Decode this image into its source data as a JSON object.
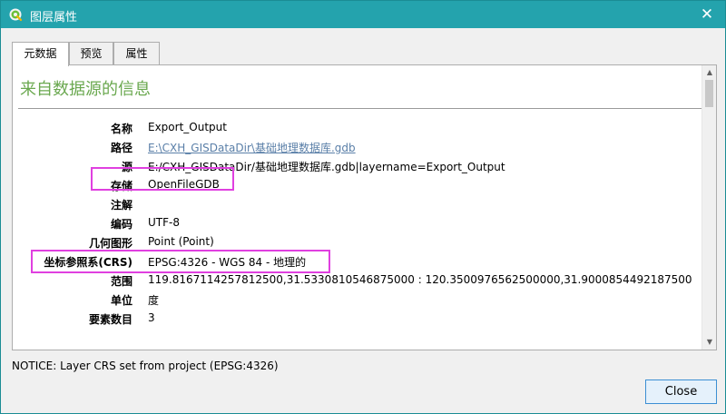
{
  "window": {
    "title": "图层属性",
    "close_glyph": "✕",
    "icon": "qgis-icon"
  },
  "tabs": [
    {
      "label": "元数据",
      "active": true
    },
    {
      "label": "预览",
      "active": false
    },
    {
      "label": "属性",
      "active": false
    }
  ],
  "metadata": {
    "heading": "来自数据源的信息",
    "rows": [
      {
        "label": "名称",
        "value": "Export_Output"
      },
      {
        "label": "路径",
        "value": "E:\\CXH_GISDataDir\\基础地理数据库.gdb"
      },
      {
        "label": "源",
        "value": "E:/CXH_GISDataDir/基础地理数据库.gdb|layername=Export_Output"
      },
      {
        "label": "存储",
        "value": "OpenFileGDB"
      },
      {
        "label": "注解",
        "value": ""
      },
      {
        "label": "编码",
        "value": "UTF-8"
      },
      {
        "label": "几何图形",
        "value": "Point (Point)"
      },
      {
        "label": "坐标参照系(CRS)",
        "value": "EPSG:4326 - WGS 84 - 地理的"
      },
      {
        "label": "范围",
        "value": "119.8167114257812500,31.5330810546875000 : 120.3500976562500000,31.9000854492187500"
      },
      {
        "label": "单位",
        "value": "度"
      },
      {
        "label": "要素数目",
        "value": "3"
      }
    ]
  },
  "scrollbar": {
    "up_glyph": "▲",
    "down_glyph": "▼"
  },
  "notice": "NOTICE: Layer CRS set from project (EPSG:4326)",
  "buttons": {
    "close_label": "Close"
  },
  "colors": {
    "titlebar": "#24a3ad",
    "heading": "#6aa84f",
    "link": "#5a7fa8",
    "highlight": "#e040e0"
  }
}
